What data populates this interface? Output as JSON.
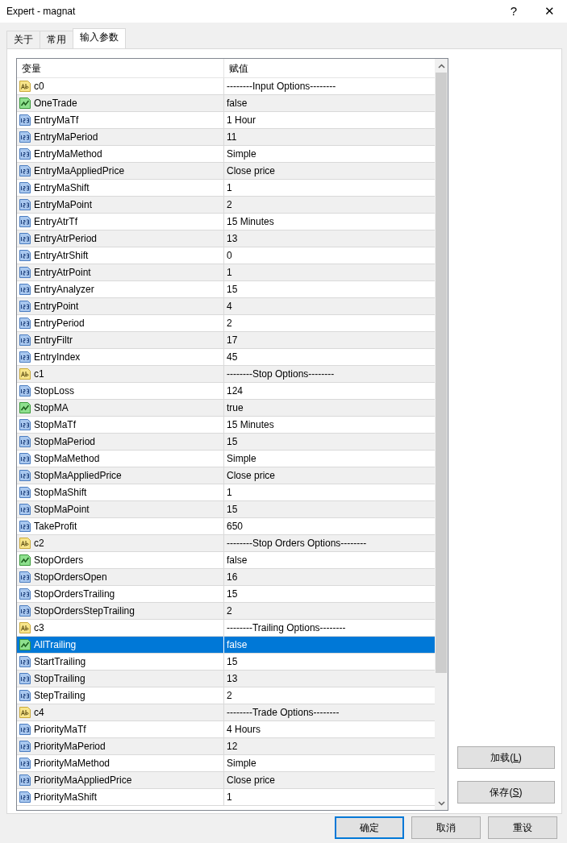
{
  "window": {
    "title": "Expert - magnat",
    "help": "?",
    "close": "✕"
  },
  "tabs": [
    {
      "label": "关于",
      "selected": false
    },
    {
      "label": "常用",
      "selected": false
    },
    {
      "label": "输入参数",
      "selected": true
    }
  ],
  "table": {
    "columns": [
      "变量",
      "赋值"
    ],
    "rows": [
      {
        "kind": "string",
        "name": "c0",
        "value": "--------Input Options--------",
        "selected": false
      },
      {
        "kind": "bool",
        "name": "OneTrade",
        "value": "false",
        "selected": false
      },
      {
        "kind": "number",
        "name": "EntryMaTf",
        "value": "1 Hour",
        "selected": false
      },
      {
        "kind": "number",
        "name": "EntryMaPeriod",
        "value": "11",
        "selected": false
      },
      {
        "kind": "number",
        "name": "EntryMaMethod",
        "value": "Simple",
        "selected": false
      },
      {
        "kind": "number",
        "name": "EntryMaAppliedPrice",
        "value": "Close price",
        "selected": false
      },
      {
        "kind": "number",
        "name": "EntryMaShift",
        "value": "1",
        "selected": false
      },
      {
        "kind": "number",
        "name": "EntryMaPoint",
        "value": "2",
        "selected": false
      },
      {
        "kind": "number",
        "name": "EntryAtrTf",
        "value": "15 Minutes",
        "selected": false
      },
      {
        "kind": "number",
        "name": "EntryAtrPeriod",
        "value": "13",
        "selected": false
      },
      {
        "kind": "number",
        "name": "EntryAtrShift",
        "value": "0",
        "selected": false
      },
      {
        "kind": "number",
        "name": "EntryAtrPoint",
        "value": "1",
        "selected": false
      },
      {
        "kind": "number",
        "name": "EntryAnalyzer",
        "value": "15",
        "selected": false
      },
      {
        "kind": "number",
        "name": "EntryPoint",
        "value": "4",
        "selected": false
      },
      {
        "kind": "number",
        "name": "EntryPeriod",
        "value": "2",
        "selected": false
      },
      {
        "kind": "number",
        "name": "EntryFiltr",
        "value": "17",
        "selected": false
      },
      {
        "kind": "number",
        "name": "EntryIndex",
        "value": "45",
        "selected": false
      },
      {
        "kind": "string",
        "name": "c1",
        "value": "--------Stop Options--------",
        "selected": false
      },
      {
        "kind": "number",
        "name": "StopLoss",
        "value": "124",
        "selected": false
      },
      {
        "kind": "bool",
        "name": "StopMA",
        "value": "true",
        "selected": false
      },
      {
        "kind": "number",
        "name": "StopMaTf",
        "value": "15 Minutes",
        "selected": false
      },
      {
        "kind": "number",
        "name": "StopMaPeriod",
        "value": "15",
        "selected": false
      },
      {
        "kind": "number",
        "name": "StopMaMethod",
        "value": "Simple",
        "selected": false
      },
      {
        "kind": "number",
        "name": "StopMaAppliedPrice",
        "value": "Close price",
        "selected": false
      },
      {
        "kind": "number",
        "name": "StopMaShift",
        "value": "1",
        "selected": false
      },
      {
        "kind": "number",
        "name": "StopMaPoint",
        "value": "15",
        "selected": false
      },
      {
        "kind": "number",
        "name": "TakeProfit",
        "value": "650",
        "selected": false
      },
      {
        "kind": "string",
        "name": "c2",
        "value": "--------Stop Orders Options--------",
        "selected": false
      },
      {
        "kind": "bool",
        "name": "StopOrders",
        "value": "false",
        "selected": false
      },
      {
        "kind": "number",
        "name": "StopOrdersOpen",
        "value": "16",
        "selected": false
      },
      {
        "kind": "number",
        "name": "StopOrdersTrailing",
        "value": "15",
        "selected": false
      },
      {
        "kind": "number",
        "name": "StopOrdersStepTrailing",
        "value": "2",
        "selected": false
      },
      {
        "kind": "string",
        "name": "c3",
        "value": "--------Trailing Options--------",
        "selected": false
      },
      {
        "kind": "bool",
        "name": "AllTrailing",
        "value": "false",
        "selected": true
      },
      {
        "kind": "number",
        "name": "StartTrailing",
        "value": "15",
        "selected": false
      },
      {
        "kind": "number",
        "name": "StopTrailing",
        "value": "13",
        "selected": false
      },
      {
        "kind": "number",
        "name": "StepTrailing",
        "value": "2",
        "selected": false
      },
      {
        "kind": "string",
        "name": "c4",
        "value": "--------Trade Options--------",
        "selected": false
      },
      {
        "kind": "number",
        "name": "PriorityMaTf",
        "value": "4 Hours",
        "selected": false
      },
      {
        "kind": "number",
        "name": "PriorityMaPeriod",
        "value": "12",
        "selected": false
      },
      {
        "kind": "number",
        "name": "PriorityMaMethod",
        "value": "Simple",
        "selected": false
      },
      {
        "kind": "number",
        "name": "PriorityMaAppliedPrice",
        "value": "Close price",
        "selected": false
      },
      {
        "kind": "number",
        "name": "PriorityMaShift",
        "value": "1",
        "selected": false
      }
    ]
  },
  "side_buttons": [
    {
      "before": "加载(",
      "key": "L",
      "after": ")"
    },
    {
      "before": "保存(",
      "key": "S",
      "after": ")"
    }
  ],
  "buttons": [
    {
      "label": "确定",
      "default": true
    },
    {
      "label": "取消",
      "default": false
    },
    {
      "label": "重设",
      "default": false
    }
  ]
}
